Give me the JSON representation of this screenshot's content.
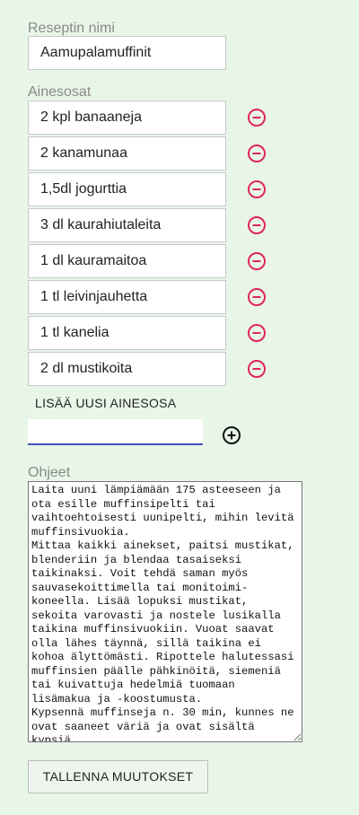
{
  "recipe_name": {
    "label": "Reseptin nimi",
    "value": "Aamupalamuffinit"
  },
  "ingredients": {
    "label": "Ainesosat",
    "items": [
      "2 kpl banaaneja",
      "2 kanamunaa",
      "1,5dl jogurttia",
      "3 dl kaurahiutaleita",
      "1 dl kauramaitoa",
      "1 tl leivinjauhetta",
      "1 tl kanelia",
      "2 dl mustikoita"
    ],
    "remove_icon": "minus-circle-icon",
    "remove_color": "#e0245e"
  },
  "new_ingredient": {
    "label": "LISÄÄ UUSI AINESOSA",
    "value": "",
    "add_icon": "plus-circle-icon"
  },
  "instructions": {
    "label": "Ohjeet",
    "text": "Laita uuni lämpiämään 175 asteeseen ja ota esille muffinsipelti tai vaihtoehtoisesti uunipelti, mihin levitä muffinsivuokia.\nMittaa kaikki ainekset, paitsi mustikat, blenderiin ja blendaa tasaiseksi taikinaksi. Voit tehdä saman myös sauvasekoittimella tai monitoimi-koneella. Lisää lopuksi mustikat, sekoita varovasti ja nostele lusikalla taikina muffinsivuokiin. Vuoat saavat olla lähes täynnä, sillä taikina ei kohoa älyttömästi. Ripottele halutessasi muffinsien päälle pähkinöitä, siemeniä tai kuivattuja hedelmiä tuomaan lisämakua ja -koostumusta.\nKypsennä muffinseja n. 30 min, kunnes ne ovat saaneet väriä ja ovat sisältä kypsiä."
  },
  "save_button": {
    "label": "TALLENNA MUUTOKSET"
  },
  "colors": {
    "background": "#e8f6e8",
    "accent": "#3f51b5",
    "remove": "#e0245e"
  }
}
